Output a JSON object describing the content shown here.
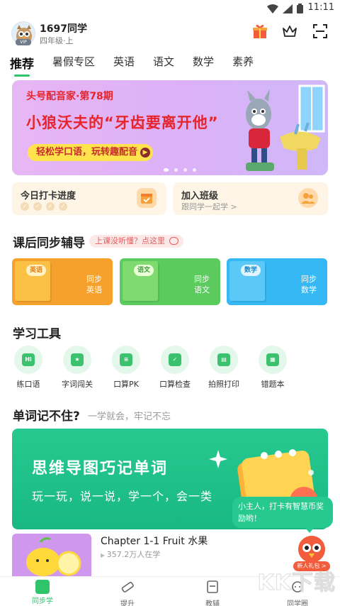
{
  "status_bar": {
    "time": "11:11",
    "icons": [
      "wifi-icon",
      "signal-icon",
      "battery-icon"
    ]
  },
  "header": {
    "user_name": "1697同学",
    "grade": "四年级·上",
    "vip_badge": "VIP",
    "icons": [
      "gift-icon",
      "crown-icon",
      "scan-icon"
    ]
  },
  "tabs": [
    {
      "label": "推荐",
      "active": true
    },
    {
      "label": "暑假专区",
      "active": false
    },
    {
      "label": "英语",
      "active": false
    },
    {
      "label": "语文",
      "active": false
    },
    {
      "label": "数学",
      "active": false
    },
    {
      "label": "素养",
      "active": false
    }
  ],
  "banner": {
    "subtitle": "头号配音家·第78期",
    "title": "小狼沃夫的“牙齿要离开他”",
    "button": "轻松学口语，玩转趣配音",
    "page_count": 4,
    "active_page": 1
  },
  "cards": {
    "checkin": {
      "title": "今日打卡进度"
    },
    "join_class": {
      "title": "加入班级",
      "subtitle": "跟同学一起学 >"
    }
  },
  "sync": {
    "title": "课后同步辅导",
    "hint": "上课没听懂？点这里",
    "subjects": [
      {
        "tag": "英语",
        "label": "同步英语",
        "color": "#f7a12d"
      },
      {
        "tag": "语文",
        "label": "同步语文",
        "color": "#5bcb5e"
      },
      {
        "tag": "数学",
        "label": "同步数学",
        "color": "#35b8f3"
      }
    ]
  },
  "tools": {
    "title": "学习工具",
    "items": [
      {
        "label": "练口语",
        "icon": "speech-bubble-icon",
        "glyph": "Hi"
      },
      {
        "label": "字词闯关",
        "icon": "trophy-icon",
        "glyph": "★"
      },
      {
        "label": "口算PK",
        "icon": "abacus-icon",
        "glyph": "≡"
      },
      {
        "label": "口算检查",
        "icon": "check-search-icon",
        "glyph": "✓"
      },
      {
        "label": "拍照打印",
        "icon": "printer-icon",
        "glyph": "▤"
      },
      {
        "label": "错题本",
        "icon": "notebook-icon",
        "glyph": "▦"
      }
    ]
  },
  "vocab": {
    "title": "单词记不住?",
    "subtitle": "一学就会，牢记不忘",
    "banner_title": "思维导图巧记单词",
    "banner_sub": "玩一玩，说一说，学一个，会一类"
  },
  "bubble": {
    "text": "小主人，打卡有智慧币奖励哟！"
  },
  "chapter": {
    "title": "Chapter 1-1 Fruit 水果",
    "learners": "357.2万人在学"
  },
  "gift": {
    "label": "新人礼包 >"
  },
  "bottom_nav": [
    {
      "label": "同步学",
      "icon": "book-icon",
      "active": true
    },
    {
      "label": "提升",
      "icon": "ruler-icon",
      "active": false
    },
    {
      "label": "教辅",
      "icon": "textbook-icon",
      "active": false
    },
    {
      "label": "同学圈",
      "icon": "chat-icon",
      "active": false
    }
  ],
  "watermark": "KK下载",
  "colors": {
    "accent": "#2fc36a",
    "banner_red": "#e6242b",
    "mind_map_green": "#1fbf88"
  }
}
